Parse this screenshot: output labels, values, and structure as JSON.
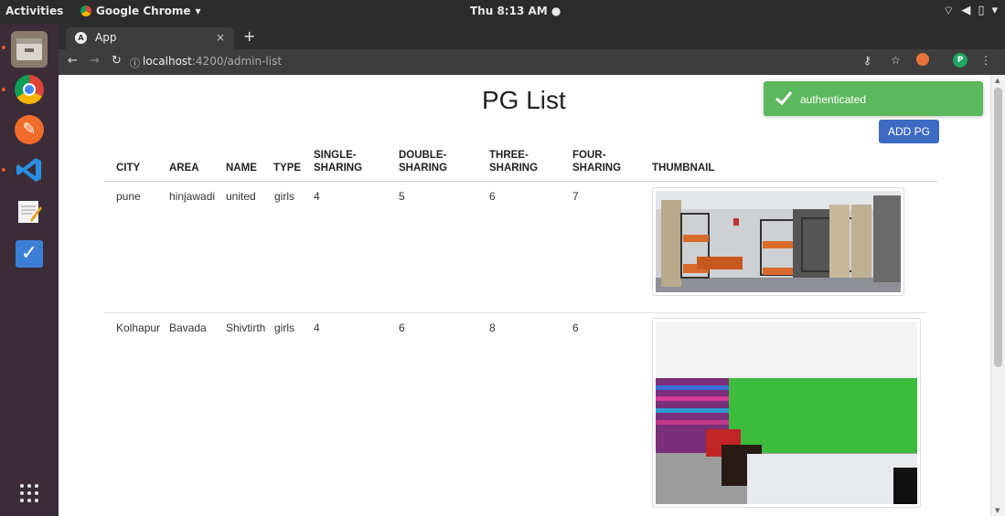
{
  "system": {
    "activities": "Activities",
    "app_menu": "Google Chrome",
    "clock": "Thu  8:13 AM"
  },
  "browser": {
    "tab_title": "App",
    "url_host": "localhost",
    "url_rest": ":4200/admin-list",
    "avatar_letter": "P"
  },
  "page": {
    "title": "PG List",
    "add_button": "ADD PG",
    "toast": "authenticated"
  },
  "table": {
    "headers": {
      "city": "CITY",
      "area": "AREA",
      "name": "NAME",
      "type": "TYPE",
      "single_1": "SINGLE-",
      "single_2": "SHARING",
      "double_1": "DOUBLE-",
      "double_2": "SHARING",
      "three_1": "THREE-",
      "three_2": "SHARING",
      "four_1": "FOUR-",
      "four_2": "SHARING",
      "thumbnail": "THUMBNAIL"
    },
    "rows": [
      {
        "city": "pune",
        "area": "hinjawadi",
        "name": "united",
        "type": "girls",
        "single": "4",
        "double": "5",
        "three": "6",
        "four": "7"
      },
      {
        "city": "Kolhapur",
        "area": "Bavada",
        "name": "Shivtirth",
        "type": "girls",
        "single": "4",
        "double": "6",
        "three": "8",
        "four": "6"
      }
    ]
  },
  "colors": {
    "toast_bg": "#5cb85c",
    "button_bg": "#3f6ac4",
    "dock_bg": "#3b2c38"
  }
}
